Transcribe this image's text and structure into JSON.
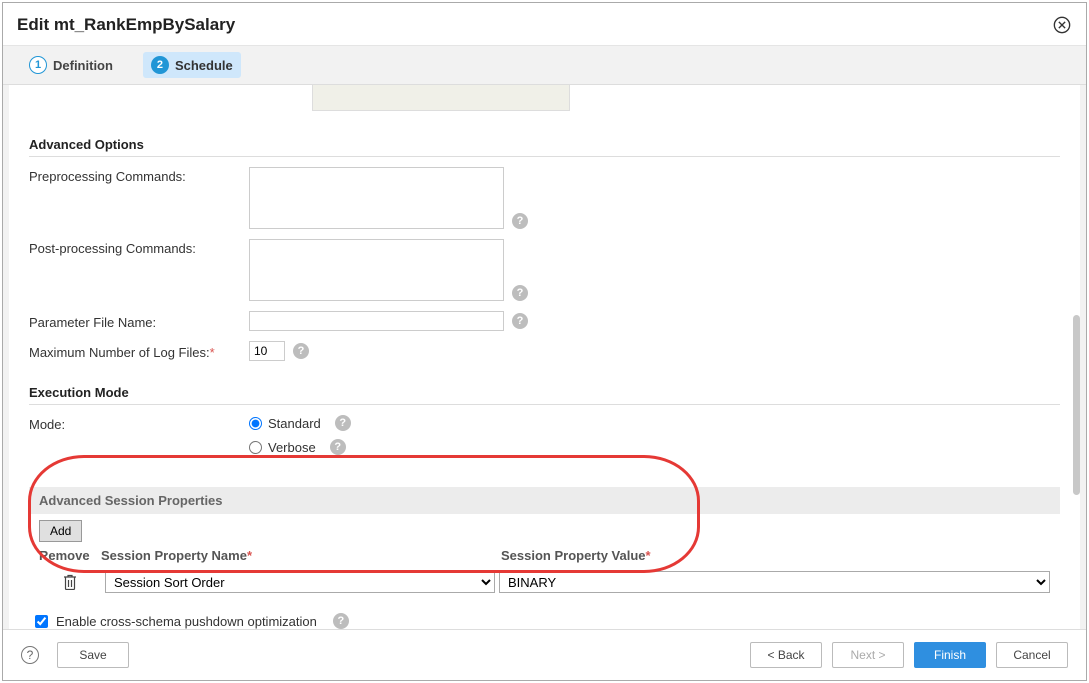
{
  "dialog": {
    "title": "Edit mt_RankEmpBySalary"
  },
  "tabs": {
    "definition": {
      "num": "1",
      "label": "Definition"
    },
    "schedule": {
      "num": "2",
      "label": "Schedule"
    }
  },
  "advancedOptions": {
    "heading": "Advanced Options",
    "preprocLabel": "Preprocessing Commands:",
    "preprocValue": "",
    "postprocLabel": "Post-processing Commands:",
    "postprocValue": "",
    "paramFileLabel": "Parameter File Name:",
    "paramFileValue": "",
    "maxLogLabel": "Maximum Number of Log Files:",
    "maxLogValue": "10"
  },
  "execMode": {
    "heading": "Execution Mode",
    "modeLabel": "Mode:",
    "standard": "Standard",
    "verbose": "Verbose"
  },
  "asp": {
    "heading": "Advanced Session Properties",
    "addLabel": "Add",
    "colRemove": "Remove",
    "colName": "Session Property Name",
    "colValue": "Session Property Value",
    "nameSel": "Session Sort Order",
    "valueSel": "BINARY"
  },
  "pushdown": {
    "label": "Enable cross-schema pushdown optimization"
  },
  "footer": {
    "save": "Save",
    "back": "< Back",
    "next": "Next >",
    "finish": "Finish",
    "cancel": "Cancel"
  }
}
